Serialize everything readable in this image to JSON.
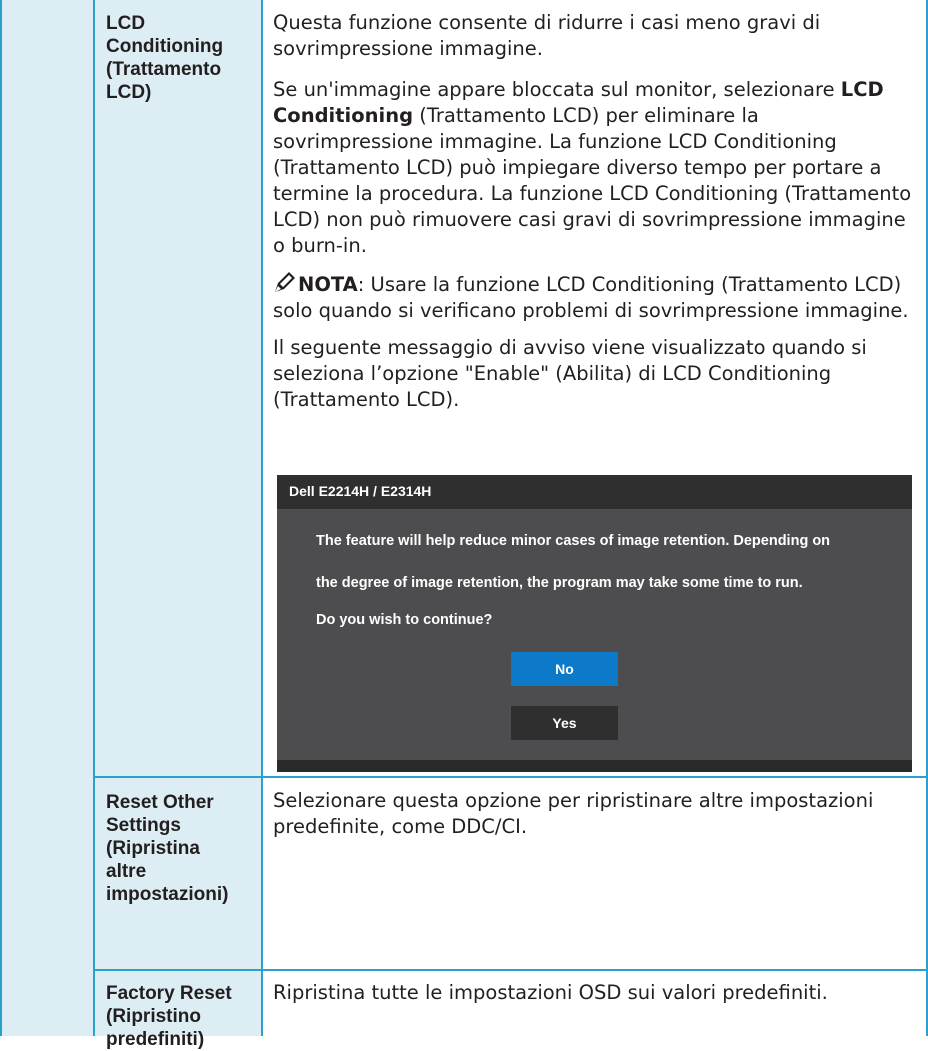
{
  "rows": [
    {
      "label_lines": [
        "LCD",
        "Conditioning",
        "(Trattamento",
        "LCD)"
      ],
      "intro": "Questa funzione consente di ridurre i casi meno gravi di sovrimpressione immagine.",
      "para2_prefix": "Se un'immagine appare bloccata sul monitor, selezionare ",
      "para2_bold": "LCD Conditioning",
      "para2_suffix": " (Trattamento LCD) per eliminare la sovrimpressione immagine. La funzione LCD Conditioning (Trattamento LCD) può impiegare diverso tempo per portare a termine la procedura. La funzione LCD Conditioning (Trattamento LCD) non può rimuovere casi gravi di sovrimpressione immagine o burn-in.",
      "note_label": "NOTA",
      "note_text": ": Usare la funzione LCD Conditioning (Trattamento LCD) solo quando si verificano problemi di sovrimpressione immagine.",
      "warning_intro": "Il seguente messaggio di avviso viene visualizzato quando si seleziona l’opzione \"Enable\" (Abilita) di LCD Conditioning (Trattamento LCD)."
    },
    {
      "label_lines": [
        "Reset Other",
        "Settings",
        "(Ripristina",
        "altre",
        "impostazioni)"
      ],
      "desc": "Selezionare questa opzione per ripristinare altre impostazioni predefinite, come DDC/CI."
    },
    {
      "label_lines": [
        "Factory Reset",
        "(Ripristino",
        "predefiniti)"
      ],
      "desc": "Ripristina tutte le impostazioni OSD sui valori predefiniti."
    }
  ],
  "osd_dialog": {
    "title": "Dell E2214H / E2314H",
    "message_lines": [
      "The feature will help reduce minor cases of image retention. Depending on",
      "the degree of image retention, the program may take some time to run.",
      "Do you wish to continue?"
    ],
    "no_label": "No",
    "yes_label": "Yes"
  },
  "colors": {
    "border": "#29a0cf",
    "tint": "#dcedf3",
    "osd_body": "#4d4d4f",
    "osd_header": "#2f2f30",
    "osd_selected": "#0c79c9"
  },
  "icons": {
    "note": "pencil-note-icon"
  }
}
